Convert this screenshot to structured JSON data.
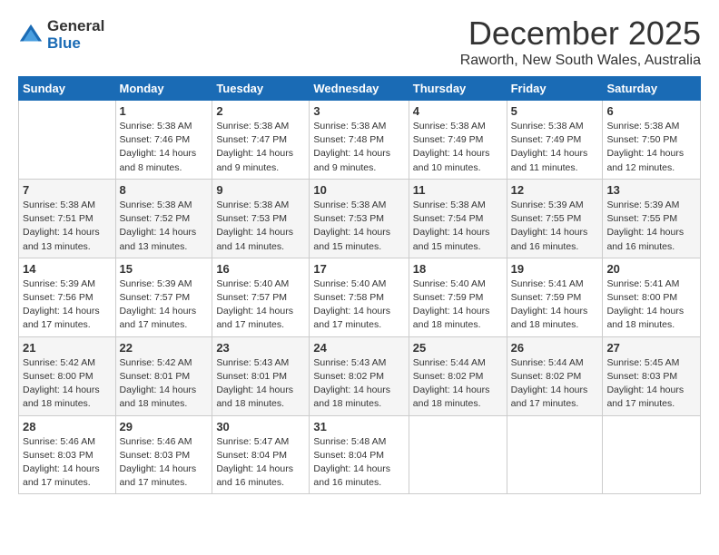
{
  "logo": {
    "general": "General",
    "blue": "Blue"
  },
  "header": {
    "month": "December 2025",
    "location": "Raworth, New South Wales, Australia"
  },
  "days_of_week": [
    "Sunday",
    "Monday",
    "Tuesday",
    "Wednesday",
    "Thursday",
    "Friday",
    "Saturday"
  ],
  "weeks": [
    [
      {
        "day": "",
        "info": ""
      },
      {
        "day": "1",
        "info": "Sunrise: 5:38 AM\nSunset: 7:46 PM\nDaylight: 14 hours\nand 8 minutes."
      },
      {
        "day": "2",
        "info": "Sunrise: 5:38 AM\nSunset: 7:47 PM\nDaylight: 14 hours\nand 9 minutes."
      },
      {
        "day": "3",
        "info": "Sunrise: 5:38 AM\nSunset: 7:48 PM\nDaylight: 14 hours\nand 9 minutes."
      },
      {
        "day": "4",
        "info": "Sunrise: 5:38 AM\nSunset: 7:49 PM\nDaylight: 14 hours\nand 10 minutes."
      },
      {
        "day": "5",
        "info": "Sunrise: 5:38 AM\nSunset: 7:49 PM\nDaylight: 14 hours\nand 11 minutes."
      },
      {
        "day": "6",
        "info": "Sunrise: 5:38 AM\nSunset: 7:50 PM\nDaylight: 14 hours\nand 12 minutes."
      }
    ],
    [
      {
        "day": "7",
        "info": "Sunrise: 5:38 AM\nSunset: 7:51 PM\nDaylight: 14 hours\nand 13 minutes."
      },
      {
        "day": "8",
        "info": "Sunrise: 5:38 AM\nSunset: 7:52 PM\nDaylight: 14 hours\nand 13 minutes."
      },
      {
        "day": "9",
        "info": "Sunrise: 5:38 AM\nSunset: 7:53 PM\nDaylight: 14 hours\nand 14 minutes."
      },
      {
        "day": "10",
        "info": "Sunrise: 5:38 AM\nSunset: 7:53 PM\nDaylight: 14 hours\nand 15 minutes."
      },
      {
        "day": "11",
        "info": "Sunrise: 5:38 AM\nSunset: 7:54 PM\nDaylight: 14 hours\nand 15 minutes."
      },
      {
        "day": "12",
        "info": "Sunrise: 5:39 AM\nSunset: 7:55 PM\nDaylight: 14 hours\nand 16 minutes."
      },
      {
        "day": "13",
        "info": "Sunrise: 5:39 AM\nSunset: 7:55 PM\nDaylight: 14 hours\nand 16 minutes."
      }
    ],
    [
      {
        "day": "14",
        "info": "Sunrise: 5:39 AM\nSunset: 7:56 PM\nDaylight: 14 hours\nand 17 minutes."
      },
      {
        "day": "15",
        "info": "Sunrise: 5:39 AM\nSunset: 7:57 PM\nDaylight: 14 hours\nand 17 minutes."
      },
      {
        "day": "16",
        "info": "Sunrise: 5:40 AM\nSunset: 7:57 PM\nDaylight: 14 hours\nand 17 minutes."
      },
      {
        "day": "17",
        "info": "Sunrise: 5:40 AM\nSunset: 7:58 PM\nDaylight: 14 hours\nand 17 minutes."
      },
      {
        "day": "18",
        "info": "Sunrise: 5:40 AM\nSunset: 7:59 PM\nDaylight: 14 hours\nand 18 minutes."
      },
      {
        "day": "19",
        "info": "Sunrise: 5:41 AM\nSunset: 7:59 PM\nDaylight: 14 hours\nand 18 minutes."
      },
      {
        "day": "20",
        "info": "Sunrise: 5:41 AM\nSunset: 8:00 PM\nDaylight: 14 hours\nand 18 minutes."
      }
    ],
    [
      {
        "day": "21",
        "info": "Sunrise: 5:42 AM\nSunset: 8:00 PM\nDaylight: 14 hours\nand 18 minutes."
      },
      {
        "day": "22",
        "info": "Sunrise: 5:42 AM\nSunset: 8:01 PM\nDaylight: 14 hours\nand 18 minutes."
      },
      {
        "day": "23",
        "info": "Sunrise: 5:43 AM\nSunset: 8:01 PM\nDaylight: 14 hours\nand 18 minutes."
      },
      {
        "day": "24",
        "info": "Sunrise: 5:43 AM\nSunset: 8:02 PM\nDaylight: 14 hours\nand 18 minutes."
      },
      {
        "day": "25",
        "info": "Sunrise: 5:44 AM\nSunset: 8:02 PM\nDaylight: 14 hours\nand 18 minutes."
      },
      {
        "day": "26",
        "info": "Sunrise: 5:44 AM\nSunset: 8:02 PM\nDaylight: 14 hours\nand 17 minutes."
      },
      {
        "day": "27",
        "info": "Sunrise: 5:45 AM\nSunset: 8:03 PM\nDaylight: 14 hours\nand 17 minutes."
      }
    ],
    [
      {
        "day": "28",
        "info": "Sunrise: 5:46 AM\nSunset: 8:03 PM\nDaylight: 14 hours\nand 17 minutes."
      },
      {
        "day": "29",
        "info": "Sunrise: 5:46 AM\nSunset: 8:03 PM\nDaylight: 14 hours\nand 17 minutes."
      },
      {
        "day": "30",
        "info": "Sunrise: 5:47 AM\nSunset: 8:04 PM\nDaylight: 14 hours\nand 16 minutes."
      },
      {
        "day": "31",
        "info": "Sunrise: 5:48 AM\nSunset: 8:04 PM\nDaylight: 14 hours\nand 16 minutes."
      },
      {
        "day": "",
        "info": ""
      },
      {
        "day": "",
        "info": ""
      },
      {
        "day": "",
        "info": ""
      }
    ]
  ]
}
